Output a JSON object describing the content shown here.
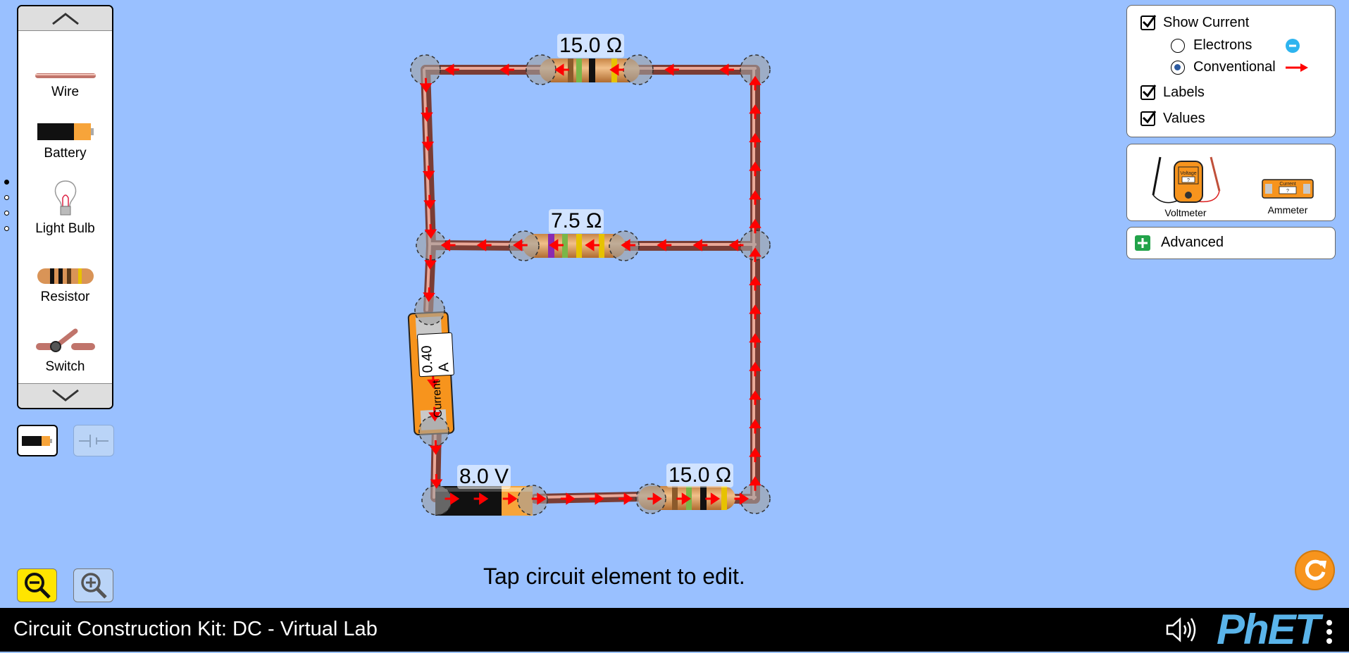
{
  "toolbox": {
    "items": [
      {
        "label": "Wire"
      },
      {
        "label": "Battery"
      },
      {
        "label": "Light Bulb"
      },
      {
        "label": "Resistor"
      },
      {
        "label": "Switch"
      }
    ],
    "page_count": 4,
    "active_page": 0
  },
  "view": {
    "lifelike": "lifelike-view",
    "schematic": "schematic-view"
  },
  "current_panel": {
    "show_current": "Show Current",
    "show_current_checked": true,
    "electrons": "Electrons",
    "conventional": "Conventional",
    "selected": "Conventional",
    "labels": "Labels",
    "labels_checked": true,
    "values": "Values",
    "values_checked": true
  },
  "meters": {
    "voltmeter": "Voltmeter",
    "voltmeter_face": "Voltage",
    "voltmeter_reading": "?",
    "ammeter": "Ammeter",
    "ammeter_face": "Current",
    "ammeter_reading": "?"
  },
  "advanced": {
    "label": "Advanced"
  },
  "circuit": {
    "resistor_top": "15.0 Ω",
    "resistor_middle": "7.5 Ω",
    "resistor_bottom": "15.0 Ω",
    "battery": "8.0 V",
    "ammeter_label": "Current",
    "ammeter_value": "0.40 A"
  },
  "hint": "Tap circuit element to edit.",
  "navbar": {
    "title": "Circuit Construction Kit: DC - Virtual Lab",
    "logo": "PhET"
  },
  "colors": {
    "background": "#99c0ff",
    "accent": "#f7941d",
    "navbar": "#000000",
    "current_arrow": "#ff0000"
  }
}
